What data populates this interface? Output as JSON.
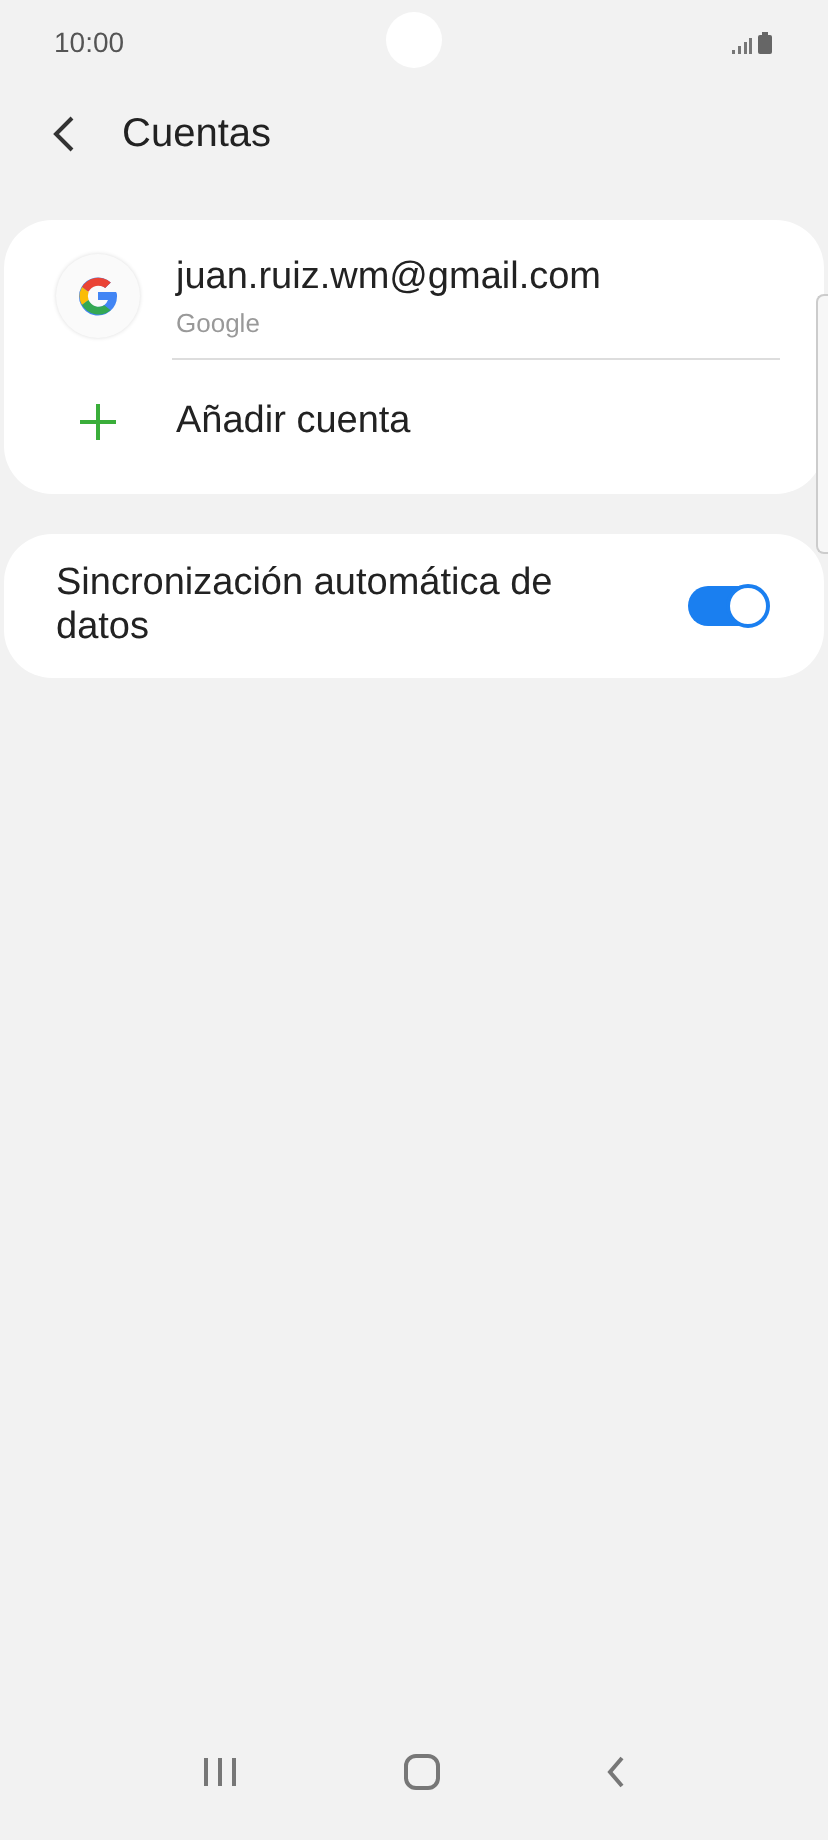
{
  "status_bar": {
    "time": "10:00"
  },
  "header": {
    "title": "Cuentas"
  },
  "accounts": [
    {
      "kind": "account",
      "email": "juan.ruiz.wm@gmail.com",
      "provider": "Google"
    },
    {
      "kind": "add",
      "label": "Añadir cuenta"
    }
  ],
  "settings": [
    {
      "label": "Sincronización automática de datos",
      "on": true
    }
  ]
}
